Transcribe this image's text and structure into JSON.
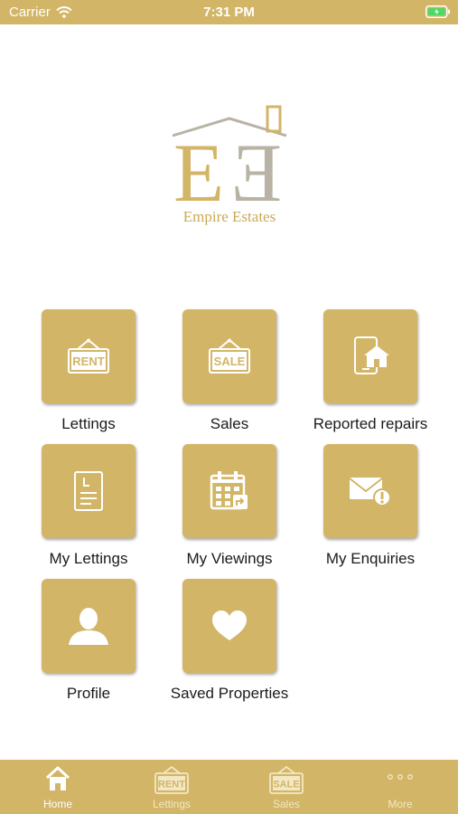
{
  "status_bar": {
    "carrier": "Carrier",
    "time": "7:31 PM"
  },
  "logo": {
    "company_name": "Empire Estates"
  },
  "tiles": [
    {
      "label": "Lettings",
      "sign_text": "RENT",
      "icon": "rent-sign-icon"
    },
    {
      "label": "Sales",
      "sign_text": "SALE",
      "icon": "sale-sign-icon"
    },
    {
      "label": "Reported repairs",
      "icon": "phone-house-icon"
    },
    {
      "label": "My Lettings",
      "icon": "document-icon"
    },
    {
      "label": "My Viewings",
      "icon": "calendar-icon"
    },
    {
      "label": "My Enquiries",
      "icon": "mail-alert-icon"
    },
    {
      "label": "Profile",
      "icon": "user-icon"
    },
    {
      "label": "Saved Properties",
      "icon": "heart-icon"
    }
  ],
  "tab_bar": {
    "active": "Home",
    "tabs": [
      {
        "label": "Home",
        "icon": "home-icon"
      },
      {
        "label": "Lettings",
        "sign_text": "RENT",
        "icon": "rent-sign-icon"
      },
      {
        "label": "Sales",
        "sign_text": "SALE",
        "icon": "sale-sign-icon"
      },
      {
        "label": "More",
        "icon": "more-dots-icon"
      }
    ]
  },
  "colors": {
    "brand_gold": "#d2b566",
    "logo_grey": "#b8b3a4",
    "text_dark": "#1b1b1b"
  }
}
